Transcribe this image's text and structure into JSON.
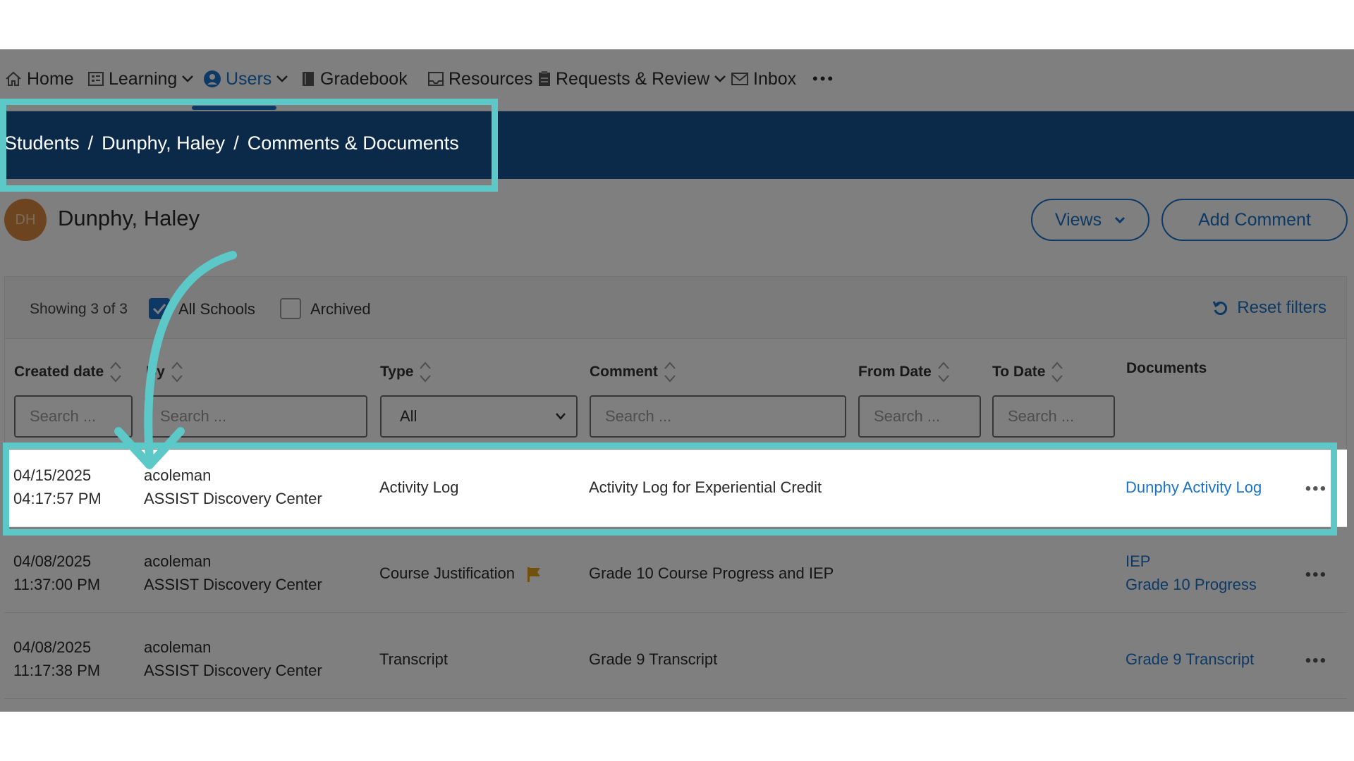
{
  "nav": {
    "items": [
      {
        "label": "Home",
        "icon": "home-icon"
      },
      {
        "label": "Learning",
        "icon": "grid-icon"
      },
      {
        "label": "Users",
        "icon": "user-circle-icon"
      },
      {
        "label": "Gradebook",
        "icon": "book-icon"
      },
      {
        "label": "Resources",
        "icon": "tray-icon"
      },
      {
        "label": "Requests & Review",
        "icon": "clipboard-icon"
      },
      {
        "label": "Inbox",
        "icon": "mail-icon"
      }
    ],
    "more": "•••"
  },
  "breadcrumb": {
    "items": [
      "Students",
      "Dunphy, Haley",
      "Comments & Documents"
    ],
    "separator": "/"
  },
  "student": {
    "initials": "DH",
    "name": "Dunphy, Haley",
    "views_label": "Views",
    "add_comment_label": "Add Comment"
  },
  "filters": {
    "showing": "Showing 3 of 3",
    "all_schools_label": "All Schools",
    "all_schools_checked": true,
    "archived_label": "Archived",
    "archived_checked": false,
    "reset_label": "Reset filters"
  },
  "columns": {
    "created_date": {
      "label": "Created date",
      "placeholder": "Search ..."
    },
    "by": {
      "label": "By",
      "placeholder": "Search ..."
    },
    "type": {
      "label": "Type",
      "value": "All"
    },
    "comment": {
      "label": "Comment",
      "placeholder": "Search ..."
    },
    "from_date": {
      "label": "From Date",
      "placeholder": "Search ..."
    },
    "to_date": {
      "label": "To Date",
      "placeholder": "Search ..."
    },
    "documents": {
      "label": "Documents"
    }
  },
  "rows": [
    {
      "date": "04/15/2025",
      "time": "04:17:57 PM",
      "user": "acoleman",
      "school": "ASSIST Discovery Center",
      "type": "Activity Log",
      "flagged": false,
      "comment": "Activity Log for Experiential Credit",
      "docs": [
        "Dunphy Activity Log"
      ]
    },
    {
      "date": "04/08/2025",
      "time": "11:37:00 PM",
      "user": "acoleman",
      "school": "ASSIST Discovery Center",
      "type": "Course Justification",
      "flagged": true,
      "comment": "Grade 10 Course Progress and IEP",
      "docs": [
        "IEP",
        "Grade 10 Progress"
      ]
    },
    {
      "date": "04/08/2025",
      "time": "11:17:38 PM",
      "user": "acoleman",
      "school": "ASSIST Discovery Center",
      "type": "Transcript",
      "flagged": false,
      "comment": "Grade 9 Transcript",
      "docs": [
        "Grade 9 Transcript"
      ]
    }
  ],
  "row_more": "•••",
  "colors": {
    "accent": "#1a73c9",
    "breadcrumb_bg": "#0b2a4a",
    "highlight": "#5dc8c8",
    "flag": "#e0a21a",
    "avatar": "#d9893f"
  }
}
